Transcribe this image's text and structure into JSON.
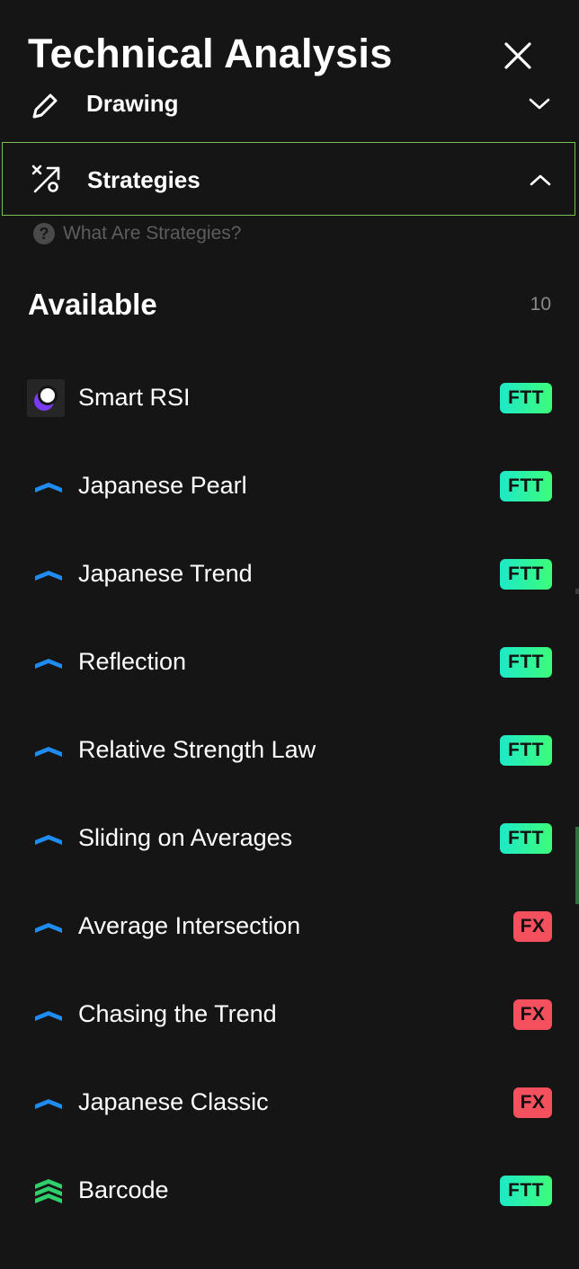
{
  "header": {
    "title": "Technical Analysis"
  },
  "accordions": {
    "drawing": {
      "label": "Drawing",
      "expanded": false
    },
    "strategies": {
      "label": "Strategies",
      "expanded": true
    }
  },
  "help": {
    "icon": "?",
    "label": "What Are Strategies?"
  },
  "section": {
    "title": "Available",
    "count": "10"
  },
  "strategies": [
    {
      "label": "Smart RSI",
      "badge": "FTT",
      "icon": "smart-rsi-icon"
    },
    {
      "label": "Japanese Pearl",
      "badge": "FTT",
      "icon": "chevron-strategy-icon"
    },
    {
      "label": "Japanese Trend",
      "badge": "FTT",
      "icon": "chevron-strategy-icon"
    },
    {
      "label": "Reflection",
      "badge": "FTT",
      "icon": "chevron-strategy-icon"
    },
    {
      "label": "Relative Strength Law",
      "badge": "FTT",
      "icon": "chevron-strategy-icon"
    },
    {
      "label": "Sliding on Averages",
      "badge": "FTT",
      "icon": "chevron-strategy-icon"
    },
    {
      "label": "Average Intersection",
      "badge": "FX",
      "icon": "chevron-strategy-icon"
    },
    {
      "label": "Chasing the Trend",
      "badge": "FX",
      "icon": "chevron-strategy-icon"
    },
    {
      "label": "Japanese Classic",
      "badge": "FX",
      "icon": "chevron-strategy-icon"
    },
    {
      "label": "Barcode",
      "badge": "FTT",
      "icon": "stacked-chevron-icon"
    }
  ],
  "colors": {
    "background": "#151515",
    "accent_border": "#7bbf54",
    "ftt_badge": "#1de9c8",
    "fx_badge": "#f4505d",
    "chevron_icon": "#1f8cf2",
    "barcode_icon": "#2fcf6e"
  }
}
